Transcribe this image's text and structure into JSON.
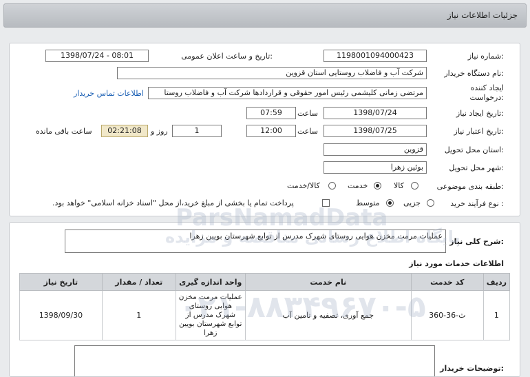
{
  "page_title": "جزئیات اطلاعات نیاز",
  "need_number": {
    "label": "شماره نیاز:",
    "value": "1198001094000423"
  },
  "announce_datetime": {
    "label": "تاریخ و ساعت اعلان عمومی:",
    "value": "1398/07/24 - 08:01"
  },
  "buyer_org": {
    "label": "نام دستگاه خریدار:",
    "value": "شرکت آب و فاضلاب روستایی استان قزوین"
  },
  "requester": {
    "label": "ایجاد کننده درخواست:",
    "value": "مرتضی زمانی کلیشمی رئیس امور حقوقی و قراردادها شرکت آب و فاضلاب روستا",
    "contact_link": "اطلاعات تماس خریدار"
  },
  "need_date": {
    "label": "تاریخ ایجاد نیاز:",
    "date": "1398/07/24",
    "time_label": "ساعت",
    "time": "07:59"
  },
  "validity": {
    "label": "تاریخ اعتبار نیاز:",
    "date": "1398/07/25",
    "time_label": "ساعت",
    "time": "12:00",
    "days": "1",
    "days_label": "روز و",
    "remaining": "02:21:08",
    "remaining_label": "ساعت باقی مانده"
  },
  "delivery_province": {
    "label": "استان محل تحویل:",
    "value": "قزوین"
  },
  "delivery_city": {
    "label": "شهر محل تحویل:",
    "value": "بوئین زهرا"
  },
  "category": {
    "label": "طبقه بندی موضوعی:",
    "options": [
      "کالا",
      "خدمت",
      "کالا/خدمت"
    ],
    "selected": "خدمت"
  },
  "purchase_process": {
    "label": "نوع فرآیند خرید :",
    "options": [
      "جزیی",
      "متوسط"
    ],
    "selected": "متوسط",
    "payment_note": "پرداخت تمام یا بخشی از مبلغ خرید،از محل \"اسناد خزانه اسلامی\" خواهد بود."
  },
  "general_description": {
    "label": "شرح کلی نیاز:",
    "value": "عملیات مرمت مخزن هوایی روستای شهرک مدرس از توابع شهرستان بویین زهرا"
  },
  "services_title": "اطلاعات خدمات مورد نیاز",
  "services_table": {
    "headers": [
      "ردیف",
      "کد خدمت",
      "نام خدمت",
      "واحد اندازه گیری",
      "تعداد / مقدار",
      "تاریخ نیاز"
    ],
    "rows": [
      [
        "1",
        "ث-36-360",
        "جمع آوری، تصفیه و تامین آب",
        "عملیات مرمت مخزن هوایی روستای شهرک مدرس از توابع شهرستان بویین زهرا",
        "1",
        "1398/09/30"
      ]
    ]
  },
  "buyer_notes": {
    "label": "توضیحات خریدار:",
    "value": ""
  },
  "watermarks": [
    "ParsNamadData",
    "پایگاه اطلاع رسانی مناقصه و مزایده",
    "۰۲۱-۸۸۳۴۹۶۷۰-۵"
  ]
}
